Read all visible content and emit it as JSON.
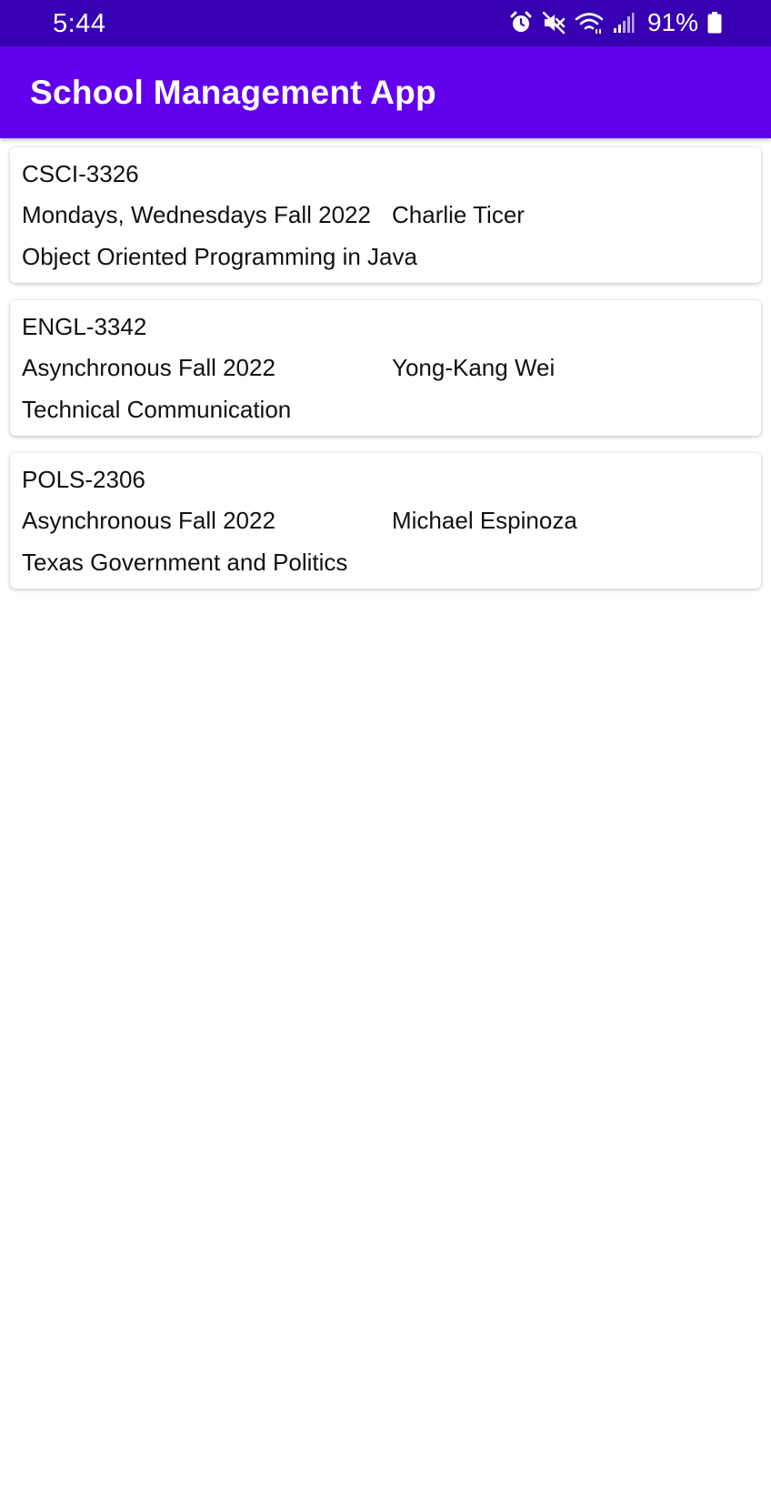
{
  "status_bar": {
    "time": "5:44",
    "battery": "91%",
    "icons": [
      "alarm-icon",
      "mute-icon",
      "wifi-icon",
      "signal-icon",
      "battery-icon"
    ]
  },
  "app_bar": {
    "title": "School Management App"
  },
  "courses": [
    {
      "code": "CSCI-3326",
      "schedule": "Mondays, Wednesdays Fall 2022",
      "instructor": "Charlie Ticer",
      "title": "Object Oriented Programming in Java"
    },
    {
      "code": "ENGL-3342",
      "schedule": "Asynchronous Fall 2022",
      "instructor": "Yong-Kang Wei",
      "title": "Technical Communication"
    },
    {
      "code": "POLS-2306",
      "schedule": "Asynchronous Fall 2022",
      "instructor": "Michael Espinoza",
      "title": "Texas Government and Politics"
    }
  ],
  "colors": {
    "status_bar": "#3700b3",
    "app_bar": "#6200ee",
    "text": "#111111"
  }
}
